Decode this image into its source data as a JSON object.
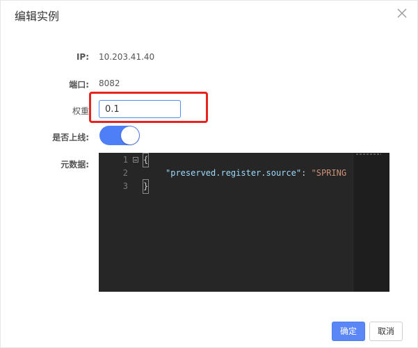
{
  "dialog": {
    "title": "编辑实例"
  },
  "form": {
    "ip_label": "IP:",
    "ip_value": "10.203.41.40",
    "port_label": "端口:",
    "port_value": "8082",
    "weight_label": "权重",
    "weight_value": "0.1",
    "online_label": "是否上线:",
    "online_enabled": true,
    "metadata_label": "元数据:"
  },
  "editor": {
    "lines": [
      {
        "number": "1",
        "text": "{"
      },
      {
        "number": "2",
        "key": "\"preserved.register.source\"",
        "sep": ": ",
        "value": "\"SPRING"
      },
      {
        "number": "3",
        "text": "}"
      }
    ]
  },
  "buttons": {
    "confirm": "确定",
    "cancel": "取消"
  },
  "colors": {
    "primary": "#5a87f5",
    "toggle_on": "#4f7ff7",
    "highlight": "#e8221e",
    "editor_bg": "#262626"
  }
}
